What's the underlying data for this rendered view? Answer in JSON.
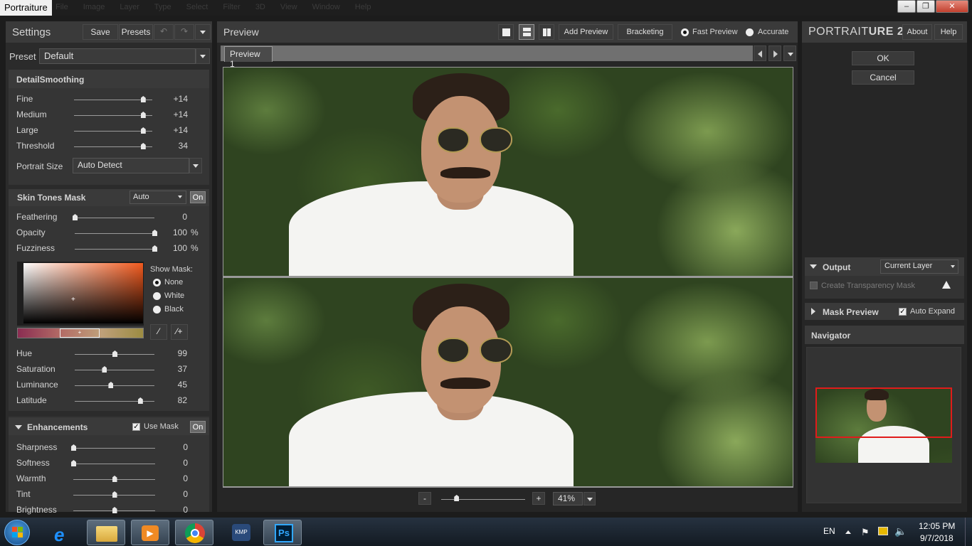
{
  "window": {
    "title": "Portraiture",
    "ghost_menu": "File Image Layer Type Select Filter 3D View Window Help",
    "controls": [
      "–",
      "❐",
      "✕"
    ]
  },
  "settings": {
    "header": "Settings",
    "save": "Save",
    "presets": "Presets",
    "preset_label": "Preset",
    "preset_value": "Default"
  },
  "detail": {
    "title": "DetailSmoothing",
    "sliders": [
      {
        "label": "Fine",
        "value": "+14",
        "pos": 0.88
      },
      {
        "label": "Medium",
        "value": "+14",
        "pos": 0.88
      },
      {
        "label": "Large",
        "value": "+14",
        "pos": 0.88
      },
      {
        "label": "Threshold",
        "value": "34",
        "pos": 0.88
      }
    ],
    "portrait_size_label": "Portrait Size",
    "portrait_size_value": "Auto Detect"
  },
  "skin": {
    "title": "Skin Tones Mask",
    "mode": "Auto",
    "on": "On",
    "sliders": [
      {
        "label": "Feathering",
        "value": "0",
        "pos": 0.0
      },
      {
        "label": "Opacity",
        "value": "100",
        "unit": "%",
        "pos": 1.0
      },
      {
        "label": "Fuzziness",
        "value": "100",
        "unit": "%",
        "pos": 1.0
      }
    ],
    "show_mask_label": "Show Mask:",
    "show_mask_options": [
      "None",
      "White",
      "Black"
    ],
    "show_mask_selected": "None",
    "hsl": [
      {
        "label": "Hue",
        "value": "99",
        "pos": 0.5
      },
      {
        "label": "Saturation",
        "value": "37",
        "pos": 0.37
      },
      {
        "label": "Luminance",
        "value": "45",
        "pos": 0.45
      },
      {
        "label": "Latitude",
        "value": "82",
        "pos": 0.82
      }
    ]
  },
  "enhancements": {
    "title": "Enhancements",
    "use_mask": "Use Mask",
    "on": "On",
    "sliders": [
      {
        "label": "Sharpness",
        "value": "0",
        "pos": 0.0
      },
      {
        "label": "Softness",
        "value": "0",
        "pos": 0.0
      },
      {
        "label": "Warmth",
        "value": "0",
        "pos": 0.5
      },
      {
        "label": "Tint",
        "value": "0",
        "pos": 0.5
      },
      {
        "label": "Brightness",
        "value": "0",
        "pos": 0.5
      }
    ]
  },
  "preview": {
    "header": "Preview",
    "add_preview": "Add Preview",
    "bracketing": "Bracketing",
    "fast_preview": "Fast Preview",
    "accurate": "Accurate",
    "tab": "Preview 1",
    "zoom_minus": "-",
    "zoom_plus": "+",
    "zoom_value": "41%",
    "zoom_pos": 0.18
  },
  "right": {
    "brand_prefix": "PORTRAIT",
    "brand_suffix": "URE 2",
    "about": "About",
    "help": "Help",
    "ok": "OK",
    "cancel": "Cancel",
    "output_title": "Output",
    "output_value": "Current Layer",
    "create_transparency": "Create Transparency Mask",
    "mask_preview": "Mask Preview",
    "auto_expand": "Auto Expand",
    "navigator": "Navigator"
  },
  "taskbar": {
    "lang": "EN",
    "time": "12:05 PM",
    "date": "9/7/2018",
    "apps": [
      "windows-start",
      "internet-explorer",
      "file-explorer",
      "media-player",
      "chrome",
      "kmplayer",
      "photoshop"
    ]
  },
  "colors": {
    "panel": "#2b2b2b",
    "header": "#3a3a3a",
    "accent_red": "#e01b1b",
    "ps_blue": "#31a8ff"
  }
}
